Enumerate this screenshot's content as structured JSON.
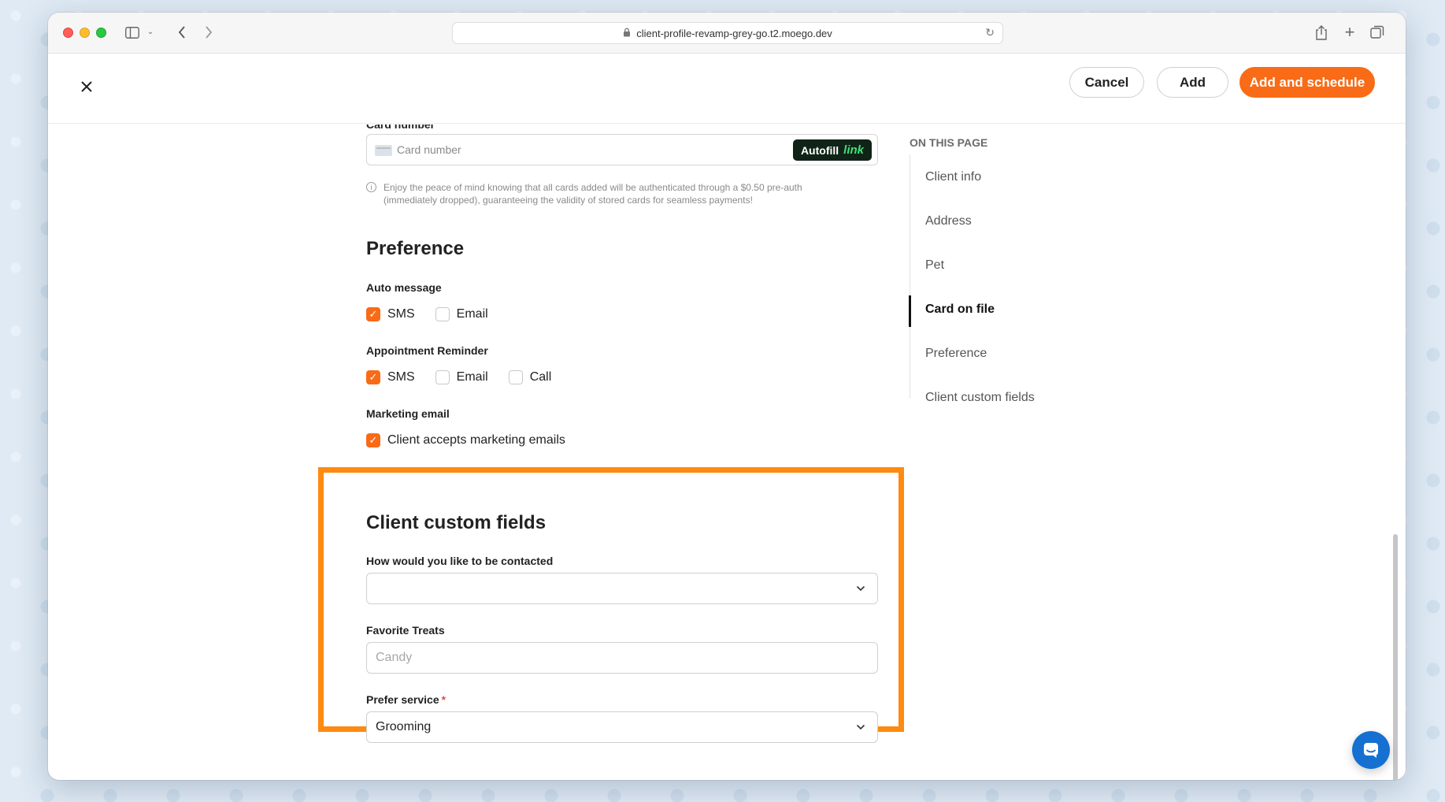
{
  "browser": {
    "url": "client-profile-revamp-grey-go.t2.moego.dev"
  },
  "header": {
    "cancel_label": "Cancel",
    "add_label": "Add",
    "add_schedule_label": "Add and schedule"
  },
  "card": {
    "label": "Card number",
    "placeholder": "Card number",
    "autofill_label": "Autofill",
    "autofill_link": "link",
    "info_text": "Enjoy the peace of mind knowing that all cards added will be authenticated through a $0.50 pre-auth (immediately dropped), guaranteeing the validity of stored cards for seamless payments!"
  },
  "preference": {
    "title": "Preference",
    "auto_message": {
      "label": "Auto message",
      "options": [
        {
          "label": "SMS",
          "checked": true
        },
        {
          "label": "Email",
          "checked": false
        }
      ]
    },
    "appointment_reminder": {
      "label": "Appointment Reminder",
      "options": [
        {
          "label": "SMS",
          "checked": true
        },
        {
          "label": "Email",
          "checked": false
        },
        {
          "label": "Call",
          "checked": false
        }
      ]
    },
    "marketing_email": {
      "label": "Marketing email",
      "options": [
        {
          "label": "Client accepts marketing emails",
          "checked": true
        }
      ]
    }
  },
  "custom_fields": {
    "title": "Client custom fields",
    "contact": {
      "label": "How would you like to be contacted",
      "value": ""
    },
    "treats": {
      "label": "Favorite Treats",
      "placeholder": "Candy"
    },
    "service": {
      "label": "Prefer service",
      "required_mark": "*",
      "value": "Grooming"
    }
  },
  "toc": {
    "title": "ON THIS PAGE",
    "items": [
      {
        "label": "Client info",
        "active": false
      },
      {
        "label": "Address",
        "active": false
      },
      {
        "label": "Pet",
        "active": false
      },
      {
        "label": "Card on file",
        "active": true
      },
      {
        "label": "Preference",
        "active": false
      },
      {
        "label": "Client custom fields",
        "active": false
      }
    ]
  },
  "colors": {
    "accent": "#f96b16",
    "highlight": "#ff8a10",
    "chat": "#1570d1"
  },
  "icons": {
    "close": "close-icon",
    "chevron": "chevron-down-icon",
    "info": "info-icon",
    "chat": "chat-icon"
  }
}
